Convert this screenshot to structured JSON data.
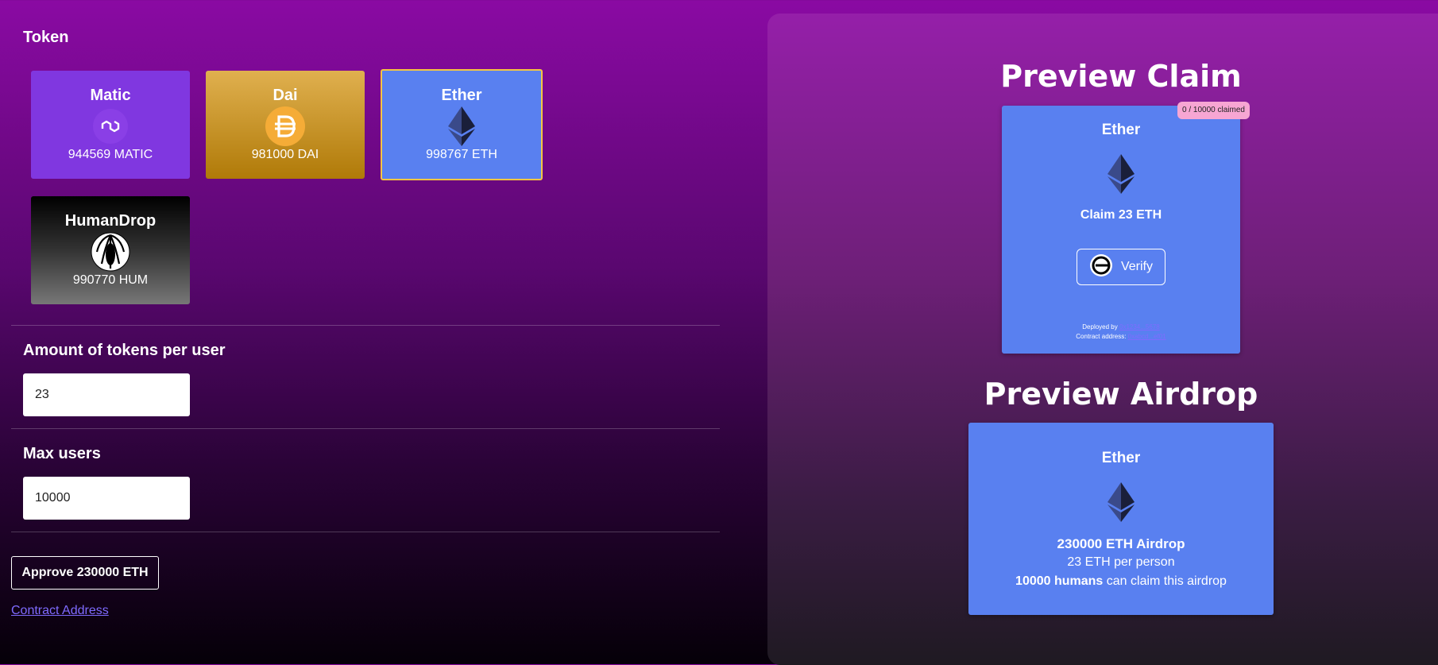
{
  "token_section": {
    "title": "Token",
    "tokens": [
      {
        "name": "Matic",
        "balance": "944569 MATIC",
        "icon": "matic-icon"
      },
      {
        "name": "Dai",
        "balance": "981000 DAI",
        "icon": "dai-icon"
      },
      {
        "name": "Ether",
        "balance": "998767 ETH",
        "icon": "ether-icon",
        "selected": true
      },
      {
        "name": "HumanDrop",
        "balance": "990770 HUM",
        "icon": "humandrop-icon"
      }
    ]
  },
  "amount_section": {
    "label": "Amount of tokens per user",
    "value": "23"
  },
  "max_users_section": {
    "label": "Max users",
    "value": "10000"
  },
  "approve_button": "Approve 230000 ETH",
  "contract_link": "Contract Address",
  "preview_claim": {
    "title": "Preview Claim",
    "badge": "0 / 10000 claimed",
    "token_name": "Ether",
    "claim_text": "Claim 23 ETH",
    "verify_label": "Verify",
    "deployed_by_label": "Deployed by",
    "deployed_by_link": "0x1234...5678",
    "contract_address_label": "Contract address:",
    "contract_address_link": "0xabcd...ef01"
  },
  "preview_airdrop": {
    "title": "Preview Airdrop",
    "token_name": "Ether",
    "total": "230000 ETH Airdrop",
    "per_person": "23 ETH per person",
    "humans_bold": "10000 humans",
    "humans_rest": " can claim this airdrop"
  },
  "colors": {
    "accent_blue": "#5980f0",
    "selected_border": "#f5c542",
    "link": "#7f6bff",
    "badge": "#f7a6d3"
  }
}
